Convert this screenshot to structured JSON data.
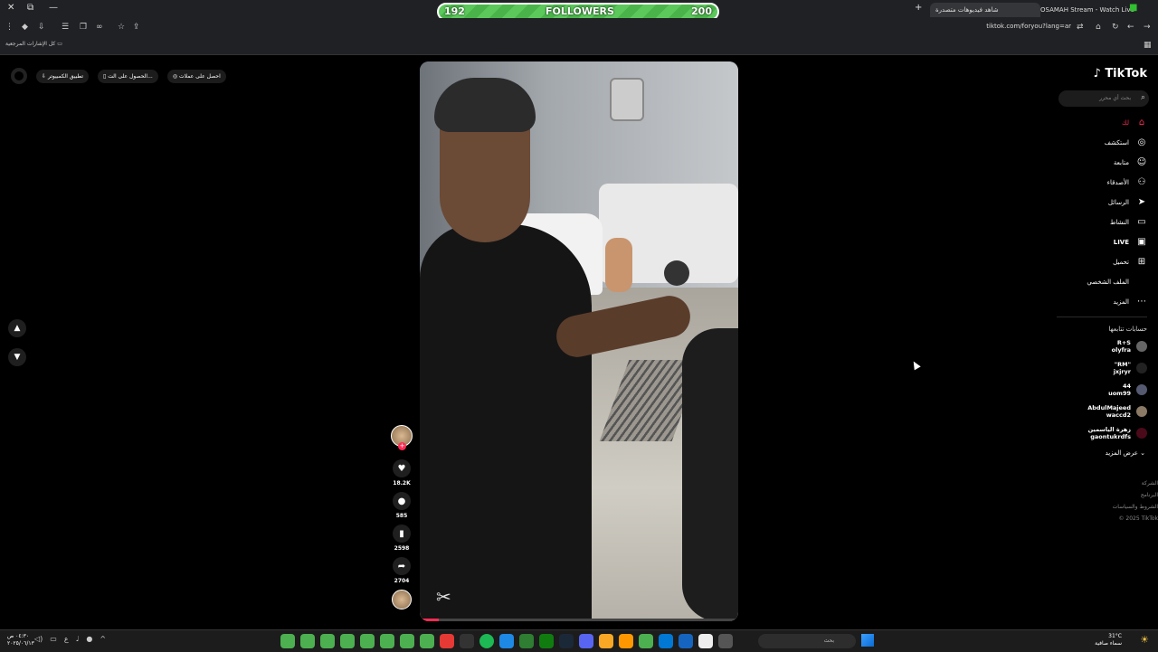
{
  "browser": {
    "tabs": [
      {
        "label": "شاهد فيديوهات متصدرة",
        "active": true
      },
      {
        "label": "OSAMAH Stream - Watch Live",
        "active": false
      }
    ],
    "url": "tiktok.com/foryou?lang=ar",
    "bookmarks_label": "كل الإشارات المرجعية"
  },
  "overlay": {
    "followers_label": "FOLLOWERS",
    "current": "192",
    "goal": "200",
    "progress_fraction": 0.96
  },
  "topbar": {
    "coins": "احصل على عملات",
    "get_app": "الحصول على الت...",
    "desktop_app": "تطبيق الكمبيوتر"
  },
  "video": {
    "watermark": "capcut-icon",
    "progress_fraction": 0.06
  },
  "actions": {
    "likes": "18.2K",
    "comments": "585",
    "saves": "2598",
    "shares": "2704"
  },
  "sidebar": {
    "logo": "TikTok",
    "search_placeholder": "بحث أي محرر",
    "nav": [
      {
        "label": "لك",
        "icon": "home-icon",
        "active": true
      },
      {
        "label": "استكشف",
        "icon": "compass-icon"
      },
      {
        "label": "متابعة",
        "icon": "user-icon"
      },
      {
        "label": "الأصدقاء",
        "icon": "friends-icon"
      },
      {
        "label": "الرسائل",
        "icon": "send-icon"
      },
      {
        "label": "النشاط",
        "icon": "inbox-icon"
      },
      {
        "label": "LIVE",
        "icon": "live-icon"
      },
      {
        "label": "تحميل",
        "icon": "upload-icon"
      },
      {
        "label": "الملف الشخصي",
        "icon": "profile-icon"
      },
      {
        "label": "المزيد",
        "icon": "more-icon"
      }
    ],
    "following_heading": "حسابات تتابعها",
    "accounts": [
      {
        "name": "R+S",
        "handle": "olyfra"
      },
      {
        "name": "\"RM\"",
        "handle": "jxjryr"
      },
      {
        "name": "44",
        "handle": "uom99"
      },
      {
        "name": "AbdulMajeed",
        "handle": "waccd2"
      },
      {
        "name": "زهرة الياسمين",
        "handle": "gaontukrdfs"
      }
    ],
    "show_more": "عرض المزيد",
    "footer": [
      "الشركة",
      "البرنامج",
      "الشروط والسياسات",
      "© 2025 TikTok"
    ]
  },
  "taskbar": {
    "search_placeholder": "بحث",
    "weather_temp": "31°C",
    "weather_desc": "سماء صافية",
    "time": "٠٤:٣٠ ص",
    "date": "٢٠٢٥/٠٦/١٣"
  },
  "colors": {
    "accent": "#fe2c55",
    "background": "#000000"
  }
}
